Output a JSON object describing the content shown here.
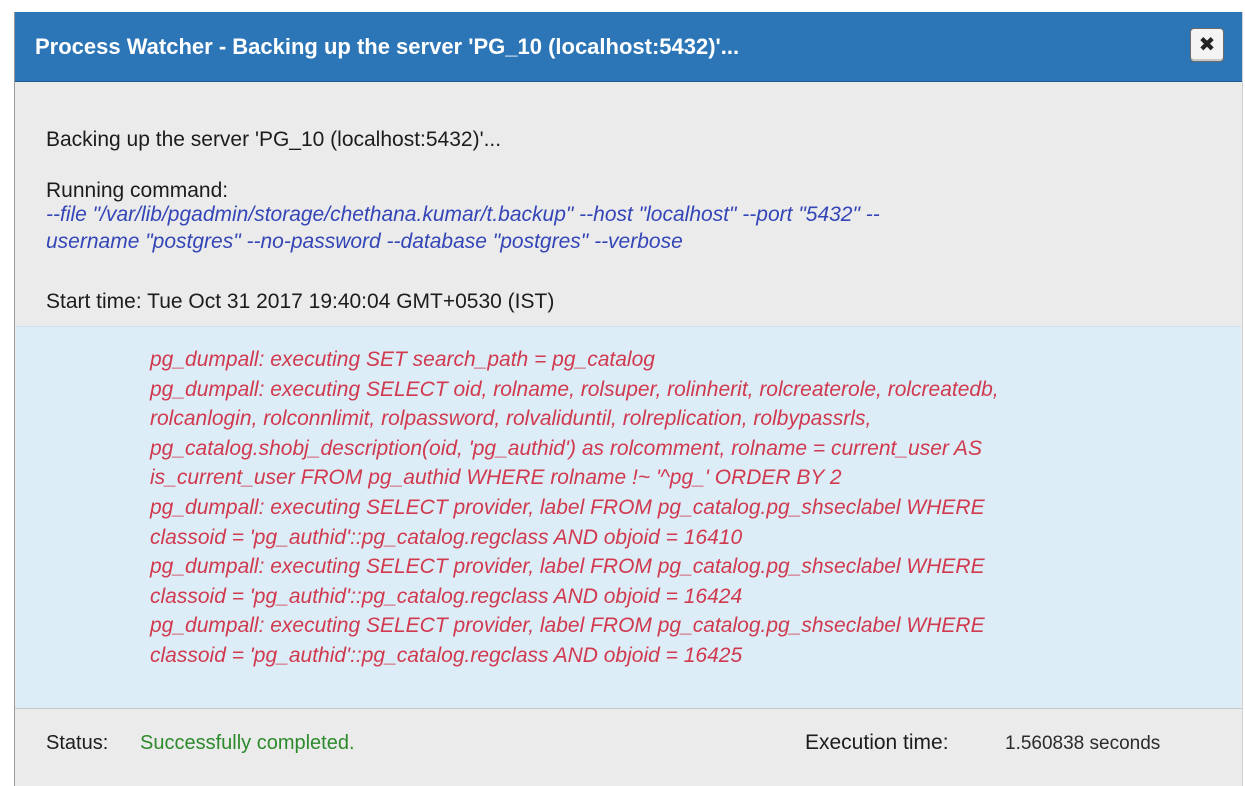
{
  "dialog": {
    "title": "Process Watcher - Backing up the server 'PG_10 (localhost:5432)'...",
    "close_icon": "close-icon"
  },
  "info": {
    "description": "Backing up the server 'PG_10 (localhost:5432)'...",
    "command_label": "Running command:",
    "command_lines": [
      "--file \"/var/lib/pgadmin/storage/chethana.kumar/t.backup\" --host \"localhost\" --port \"5432\" --",
      "username \"postgres\" --no-password --database \"postgres\" --verbose"
    ],
    "start_time": "Start time: Tue Oct 31 2017 19:40:04 GMT+0530 (IST)"
  },
  "log": {
    "lines": [
      "pg_dumpall: executing SET search_path = pg_catalog",
      "pg_dumpall: executing SELECT oid, rolname, rolsuper, rolinherit, rolcreaterole, rolcreatedb,",
      "rolcanlogin, rolconnlimit, rolpassword, rolvaliduntil, rolreplication, rolbypassrls,",
      "pg_catalog.shobj_description(oid, 'pg_authid') as rolcomment, rolname = current_user AS",
      "is_current_user FROM pg_authid WHERE rolname !~ '^pg_' ORDER BY 2",
      "pg_dumpall: executing SELECT provider, label FROM pg_catalog.pg_shseclabel WHERE",
      "classoid = 'pg_authid'::pg_catalog.regclass AND objoid = 16410",
      "pg_dumpall: executing SELECT provider, label FROM pg_catalog.pg_shseclabel WHERE",
      "classoid = 'pg_authid'::pg_catalog.regclass AND objoid = 16424",
      "pg_dumpall: executing SELECT provider, label FROM pg_catalog.pg_shseclabel WHERE",
      "classoid = 'pg_authid'::pg_catalog.regclass AND objoid = 16425"
    ]
  },
  "footer": {
    "status_label": "Status:",
    "status_value": "Successfully completed.",
    "execution_label": "Execution time:",
    "execution_value": "1.560838 seconds"
  },
  "colors": {
    "titlebar": "#2c76b7",
    "command_text": "#3345b7",
    "log_text": "#d0394e",
    "log_background": "#dcedf7",
    "status_success": "#2c8a2c"
  }
}
